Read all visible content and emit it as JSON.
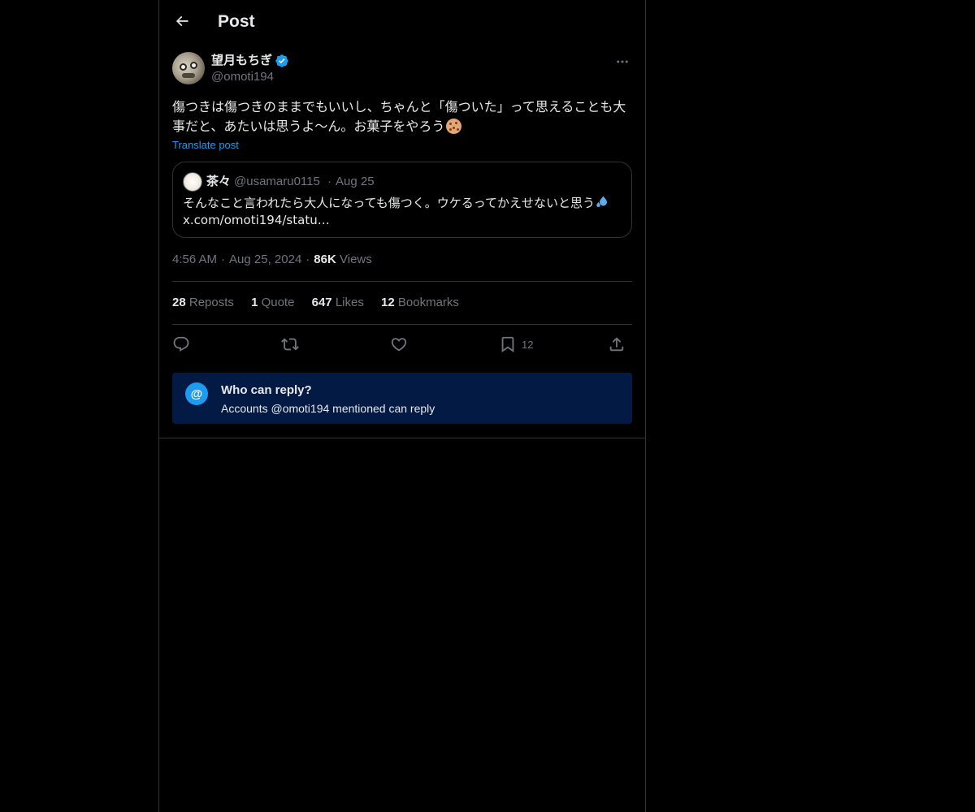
{
  "header": {
    "title": "Post",
    "back_icon": "arrow-left-icon"
  },
  "author": {
    "display_name": "望月もちぎ",
    "handle": "@omoti194",
    "verified": true,
    "verified_color": "#1d9bf0"
  },
  "post": {
    "text": "傷つきは傷つきのままでもいいし、ちゃんと「傷ついた」って思えることも大事だと、あたいは思うよ〜ん。お菓子をやろう",
    "emoji": "cookie-icon",
    "translate_label": "Translate post"
  },
  "quote": {
    "display_name": "茶々",
    "handle": "@usamaru0115",
    "separator": "·",
    "date": "Aug 25",
    "text": "そんなこと言われたら大人になっても傷つく。ウケるってかえせないと思う",
    "emoji": "sweat-droplets-icon",
    "link": "x.com/omoti194/statu…"
  },
  "meta": {
    "time": "4:56 AM",
    "separator": "·",
    "date": "Aug 25, 2024",
    "views_count": "86K",
    "views_label": "Views"
  },
  "stats": [
    {
      "count": "28",
      "label": "Reposts"
    },
    {
      "count": "1",
      "label": "Quote"
    },
    {
      "count": "647",
      "label": "Likes"
    },
    {
      "count": "12",
      "label": "Bookmarks"
    }
  ],
  "actions": {
    "reply_icon": "reply-icon",
    "repost_icon": "repost-icon",
    "like_icon": "heart-icon",
    "bookmark_icon": "bookmark-icon",
    "bookmark_count": "12",
    "share_icon": "share-icon"
  },
  "reply_restriction": {
    "icon_glyph": "@",
    "title": "Who can reply?",
    "subtitle": "Accounts @omoti194 mentioned can reply",
    "background": "#031a45",
    "accent": "#1d9bf0"
  },
  "colors": {
    "background": "#000000",
    "text": "#e7e9ea",
    "muted": "#71767b",
    "border": "#2f3336",
    "link": "#1d9bf0"
  }
}
